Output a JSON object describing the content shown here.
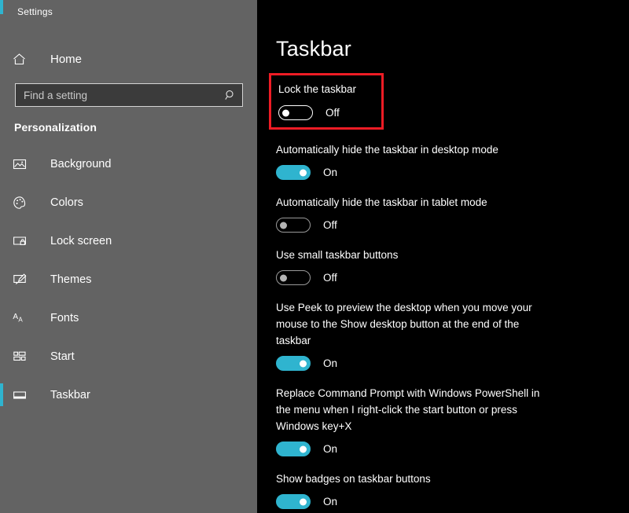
{
  "window": {
    "title": "Settings",
    "accent_color": "#2fb4cf",
    "highlight_color": "#ee1c25"
  },
  "sidebar": {
    "home": {
      "label": "Home",
      "icon": "home-icon"
    },
    "search": {
      "value": "",
      "placeholder": "Find a setting",
      "icon": "search-icon"
    },
    "section_title": "Personalization",
    "items": [
      {
        "label": "Background",
        "icon": "picture-icon",
        "selected": false
      },
      {
        "label": "Colors",
        "icon": "palette-icon",
        "selected": false
      },
      {
        "label": "Lock screen",
        "icon": "lock-screen-icon",
        "selected": false
      },
      {
        "label": "Themes",
        "icon": "themes-brush-icon",
        "selected": false
      },
      {
        "label": "Fonts",
        "icon": "fonts-aa-icon",
        "selected": false
      },
      {
        "label": "Start",
        "icon": "start-tiles-icon",
        "selected": false
      },
      {
        "label": "Taskbar",
        "icon": "taskbar-icon",
        "selected": true
      }
    ]
  },
  "main": {
    "page_title": "Taskbar",
    "settings": [
      {
        "label": "Lock the taskbar",
        "state": "Off",
        "on": false,
        "highlighted": true
      },
      {
        "label": "Automatically hide the taskbar in desktop mode",
        "state": "On",
        "on": true,
        "highlighted": false
      },
      {
        "label": "Automatically hide the taskbar in tablet mode",
        "state": "Off",
        "on": false,
        "highlighted": false
      },
      {
        "label": "Use small taskbar buttons",
        "state": "Off",
        "on": false,
        "highlighted": false
      },
      {
        "label": "Use Peek to preview the desktop when you move your mouse to the Show desktop button at the end of the taskbar",
        "state": "On",
        "on": true,
        "highlighted": false
      },
      {
        "label": "Replace Command Prompt with Windows PowerShell in the menu when I right-click the start button or press Windows key+X",
        "state": "On",
        "on": true,
        "highlighted": false
      },
      {
        "label": "Show badges on taskbar buttons",
        "state": "On",
        "on": true,
        "highlighted": false
      }
    ]
  }
}
